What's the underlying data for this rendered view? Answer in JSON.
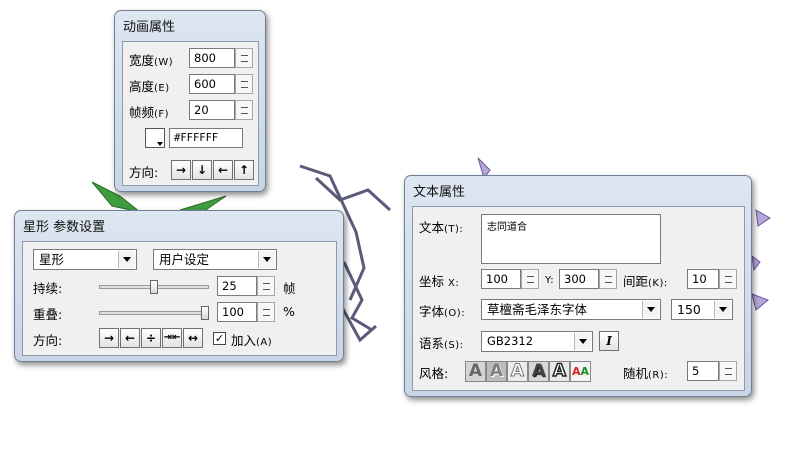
{
  "anim": {
    "title": "动画属性",
    "width_label": "宽度",
    "width_key": "(W)",
    "width_value": "800",
    "height_label": "高度",
    "height_key": "(E)",
    "height_value": "600",
    "fps_label": "帧频",
    "fps_key": "(F)",
    "fps_value": "20",
    "color_value": "#FFFFFF",
    "direction_label": "方向:",
    "dir_buttons": [
      "→",
      "↓",
      "←",
      "↑"
    ]
  },
  "star": {
    "title": "星形 参数设置",
    "shape_value": "星形",
    "preset_value": "用户设定",
    "duration_label": "持续:",
    "duration_value": "25",
    "duration_unit": "帧",
    "duration_level": 0.5,
    "overlap_label": "重叠:",
    "overlap_value": "100",
    "overlap_unit": "%",
    "overlap_level": 1.0,
    "direction_label": "方向:",
    "dir_buttons": [
      "→",
      "←",
      "÷",
      "⇥⇤",
      "↔"
    ],
    "add_label": "加入",
    "add_key": "(A)",
    "add_checked_mark": "✓"
  },
  "text": {
    "title": "文本属性",
    "text_label": "文本",
    "text_key": "(T):",
    "text_value": "志同道合",
    "coord_label": "坐标",
    "x_key": "X:",
    "x_value": "100",
    "y_key": "Y:",
    "y_value": "300",
    "spacing_label": "间距",
    "spacing_key": "(K):",
    "spacing_value": "10",
    "font_label": "字体",
    "font_key": "(O):",
    "font_value": "草檀斋毛泽东字体",
    "size_value": "150",
    "charset_label": "语系",
    "charset_key": "(S):",
    "charset_value": "GB2312",
    "italic_glyph": "I",
    "style_label": "风格:",
    "style_glyph": "A",
    "random_label": "随机",
    "random_key": "(R):",
    "random_value": "5"
  }
}
